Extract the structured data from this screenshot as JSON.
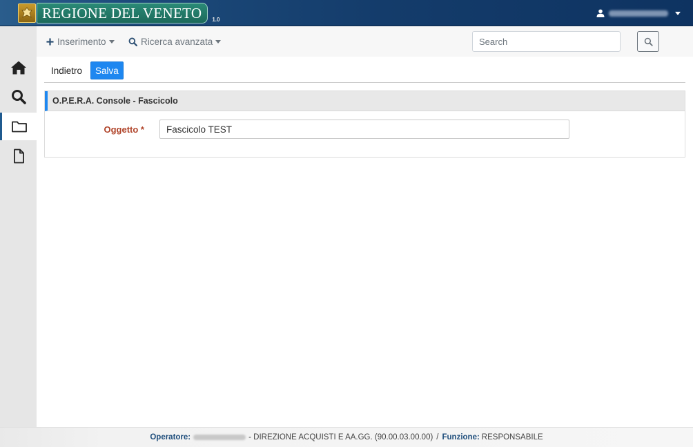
{
  "header": {
    "brand_title": "REGIONE DEL VENETO",
    "version": "1.0",
    "user_name": ""
  },
  "sidebar": {
    "items": [
      {
        "name": "home",
        "icon": "home-icon"
      },
      {
        "name": "search",
        "icon": "search-icon"
      },
      {
        "name": "folder",
        "icon": "folder-icon",
        "active": true
      },
      {
        "name": "document",
        "icon": "file-icon"
      }
    ]
  },
  "menubar": {
    "inserimento_label": "Inserimento",
    "ricerca_label": "Ricerca avanzata",
    "search_placeholder": "Search"
  },
  "actions": {
    "back_label": "Indietro",
    "save_label": "Salva"
  },
  "panel": {
    "title": "O.P.E.R.A. Console - Fascicolo",
    "field_label": "Oggetto *",
    "field_value": "Fascicolo TEST"
  },
  "footer": {
    "operator_label": "Operatore:",
    "operator_name": "",
    "office": "- DIREZIONE ACQUISTI E AA.GG. (90.00.03.00.00)",
    "separator": "/",
    "function_label": "Funzione:",
    "function_value": "RESPONSABILE"
  },
  "colors": {
    "header_bg": "#143c6b",
    "brand_bg": "#1c6a5b",
    "accent": "#1e87f0",
    "required_label": "#b0442a",
    "sidebar_bg": "#e6e6e6"
  }
}
